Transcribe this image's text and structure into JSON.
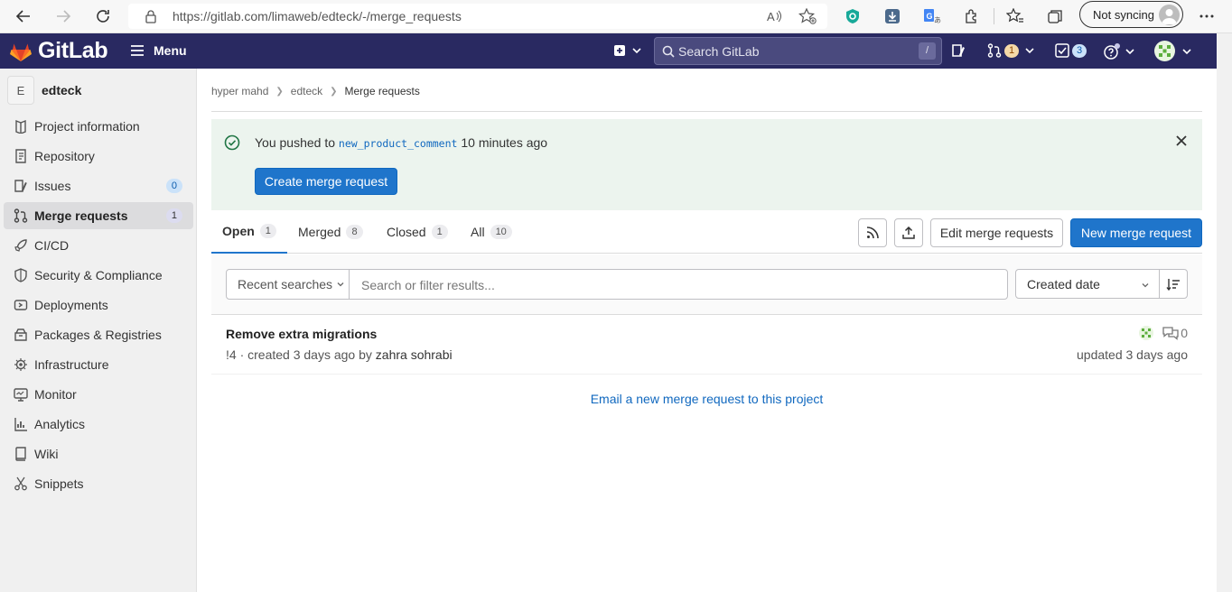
{
  "browser": {
    "url": "https://gitlab.com/limaweb/edteck/-/merge_requests",
    "sync_label": "Not syncing"
  },
  "topbar": {
    "brand": "GitLab",
    "menu_label": "Menu",
    "search_placeholder": "Search GitLab",
    "search_shortcut": "/",
    "merge_requests_count": "1",
    "todos_count": "3"
  },
  "sidebar": {
    "project_initial": "E",
    "project_name": "edteck",
    "items": [
      {
        "label": "Project information",
        "icon": "project-icon"
      },
      {
        "label": "Repository",
        "icon": "repository-icon"
      },
      {
        "label": "Issues",
        "icon": "issues-icon",
        "count": "0"
      },
      {
        "label": "Merge requests",
        "icon": "merge-request-icon",
        "count": "1",
        "active": true
      },
      {
        "label": "CI/CD",
        "icon": "rocket-icon"
      },
      {
        "label": "Security & Compliance",
        "icon": "shield-icon"
      },
      {
        "label": "Deployments",
        "icon": "deployments-icon"
      },
      {
        "label": "Packages & Registries",
        "icon": "package-icon"
      },
      {
        "label": "Infrastructure",
        "icon": "cloud-icon"
      },
      {
        "label": "Monitor",
        "icon": "monitor-icon"
      },
      {
        "label": "Analytics",
        "icon": "analytics-icon"
      },
      {
        "label": "Wiki",
        "icon": "book-icon"
      },
      {
        "label": "Snippets",
        "icon": "scissors-icon"
      }
    ]
  },
  "breadcrumb": {
    "items": [
      "hyper mahd",
      "edteck",
      "Merge requests"
    ]
  },
  "alert": {
    "prefix": "You pushed to",
    "branch": "new_product_comment",
    "suffix": "10 minutes ago",
    "button": "Create merge request"
  },
  "tabs": [
    {
      "label": "Open",
      "count": "1",
      "active": true
    },
    {
      "label": "Merged",
      "count": "8"
    },
    {
      "label": "Closed",
      "count": "1"
    },
    {
      "label": "All",
      "count": "10"
    }
  ],
  "actions": {
    "edit_label": "Edit merge requests",
    "new_label": "New merge request"
  },
  "filter": {
    "recent_searches": "Recent searches",
    "placeholder": "Search or filter results...",
    "sort_label": "Created date"
  },
  "merge_requests": [
    {
      "title": "Remove extra migrations",
      "ref": "!4",
      "created": "· created 3 days ago by",
      "author": "zahra sohrabi",
      "comments": "0",
      "updated": "updated 3 days ago"
    }
  ],
  "footer_link": "Email a new merge request to this project",
  "colors": {
    "topbar": "#292961",
    "primary": "#1f75cb",
    "alert_bg": "#ecf4ee",
    "success": "#217645"
  }
}
